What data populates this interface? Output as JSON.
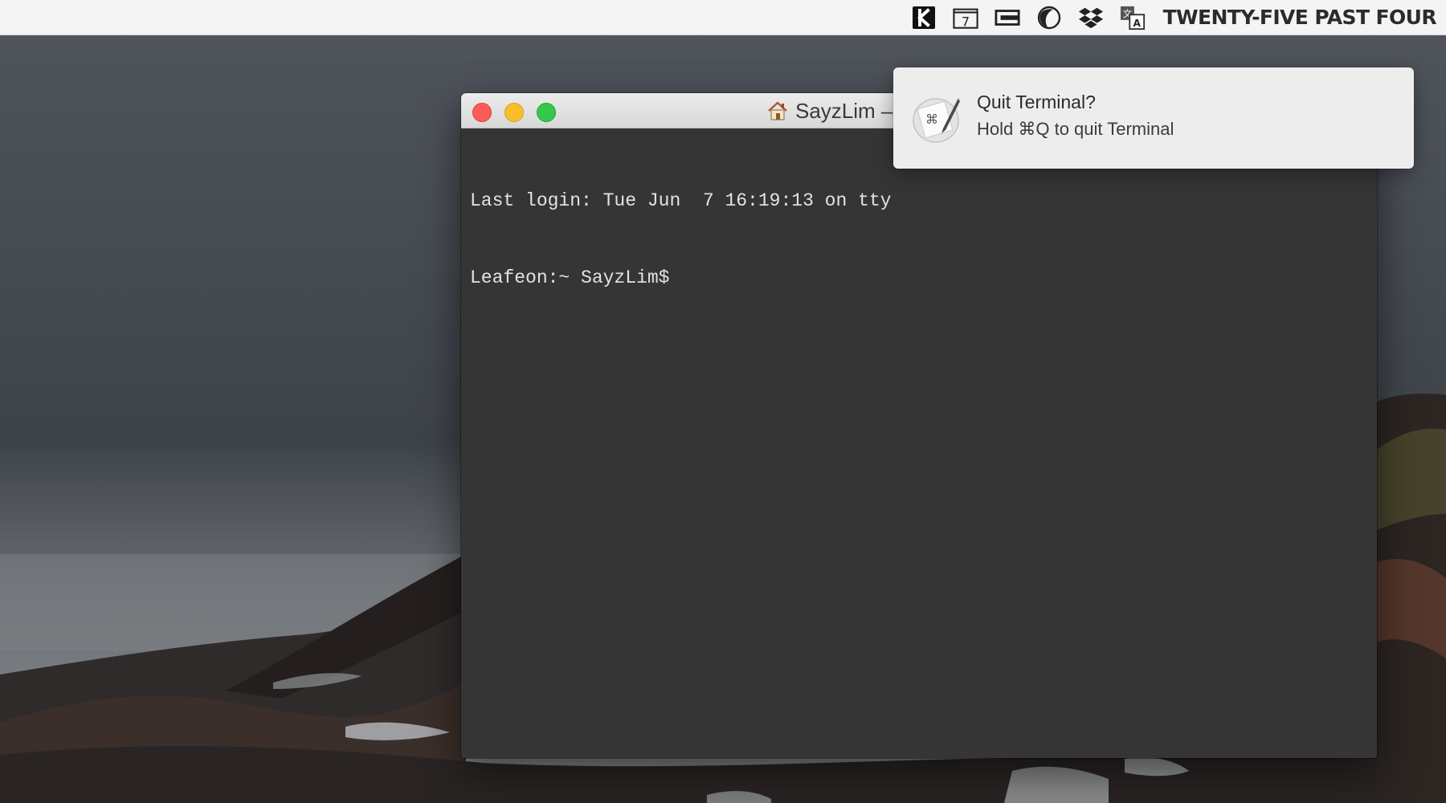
{
  "menubar": {
    "icons": [
      "k-app-icon",
      "calendar-icon",
      "monitor-icon",
      "moon-icon",
      "dropbox-icon",
      "translate-icon"
    ],
    "calendar_day": "7",
    "clock": "TWENTY-FIVE PAST FOUR"
  },
  "terminal": {
    "title": "SayzLim –",
    "lines": [
      "Last login: Tue Jun  7 16:19:13 on tty",
      "Leafeon:~ SayzLim$"
    ]
  },
  "notification": {
    "icon": "script-editor-icon",
    "title": "Quit Terminal?",
    "body": "Hold ⌘Q to quit Terminal"
  },
  "colors": {
    "terminal_bg": "#353535",
    "close": "#fc5b57",
    "minimize": "#f8be2e",
    "zoom": "#35c84a"
  }
}
